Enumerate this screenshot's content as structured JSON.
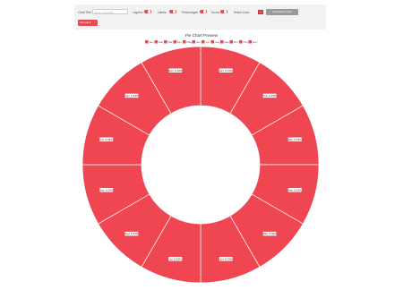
{
  "toolbar": {
    "title_label": "Chart Title:",
    "title_placeholder": "Enter chart title",
    "legend_label": "Legend:",
    "labels_label": "Labels:",
    "percentages_label": "Percentages:",
    "donut_label": "Donut:",
    "color_label": "Select Color:",
    "download_label": "Download Chart",
    "action_label": "Sample"
  },
  "chart_data": {
    "type": "pie",
    "title": "Pie Chart Preview",
    "style": "donut",
    "categories": [
      "Jan",
      "Feb",
      "Mar",
      "Apr",
      "May",
      "Jun",
      "Jul",
      "Aug",
      "Sep",
      "Oct",
      "Nov",
      "Dec"
    ],
    "values": [
      8.33,
      8.33,
      8.33,
      8.33,
      8.33,
      8.33,
      8.33,
      8.33,
      8.33,
      8.33,
      8.33,
      8.33
    ],
    "labels": [
      "Jan: 8.33%",
      "Feb: 8.33%",
      "Mar: 8.33%",
      "Apr: 8.33%",
      "May: 8.33%",
      "Jun: 8.33%",
      "Jul: 8.33%",
      "Aug: 8.33%",
      "Sep: 8.33%",
      "Oct: 8.33%",
      "Nov: 8.33%",
      "Dec: 8.33%"
    ],
    "color": "#f04651",
    "legend": "top"
  }
}
